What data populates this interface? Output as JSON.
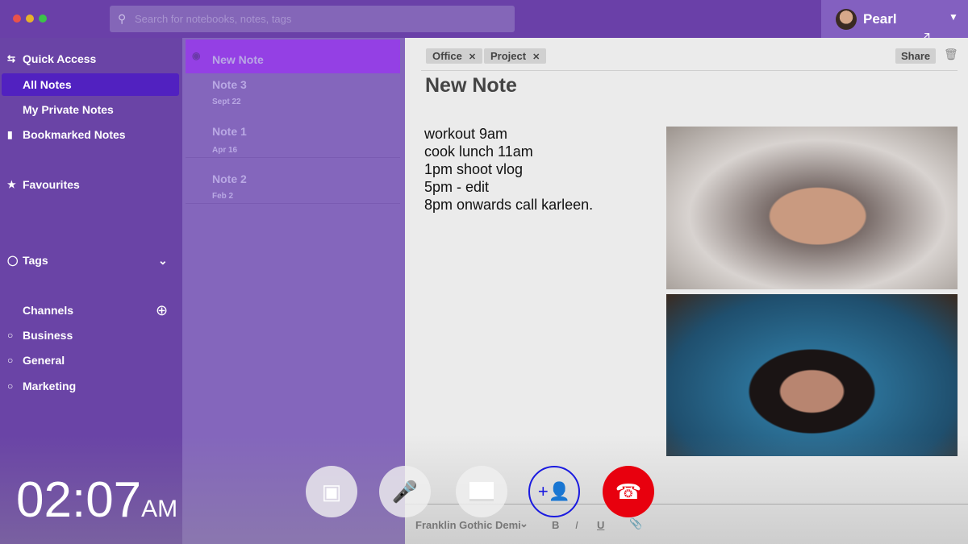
{
  "window": {
    "controls": {
      "close": "#e9524a",
      "minimize": "#e8b22a",
      "maximize": "#3cc24a"
    }
  },
  "search": {
    "placeholder": "Search for notebooks, notes, tags"
  },
  "user": {
    "name": "Pearl"
  },
  "sidebar": {
    "items": [
      {
        "label": "Quick Access",
        "icon": "swap-icon"
      },
      {
        "label": "All Notes",
        "active": true
      },
      {
        "label": "My Private Notes"
      },
      {
        "label": "Bookmarked Notes",
        "icon": "bookmark-icon"
      },
      {
        "label": "Favourites",
        "icon": "star-icon"
      },
      {
        "label": "Tags",
        "icon": "tag-icon"
      }
    ],
    "channels": {
      "label": "Channels",
      "items": [
        "Business",
        "General",
        "Marketing"
      ]
    }
  },
  "notes": [
    {
      "title": "New Note"
    },
    {
      "title": "Note 3",
      "date": "Sept 22"
    },
    {
      "title": "Note 1",
      "date": "Apr 16"
    },
    {
      "title": "Note 2",
      "date": "Feb 2"
    }
  ],
  "editor": {
    "tags": [
      "Office",
      "Project"
    ],
    "share": "Share",
    "title": "New Note",
    "lines": [
      "workout 9am",
      "cook lunch 11am",
      "1pm shoot vlog",
      "5pm - edit",
      "8pm onwards call karleen."
    ],
    "font": "Franklin Gothic Demi",
    "bold": "B",
    "italic": "I",
    "underline": "U"
  },
  "call": {
    "time": "02:07",
    "ampm": "AM",
    "end_color": "#e8000e",
    "add_color": "#1a1ae0"
  }
}
